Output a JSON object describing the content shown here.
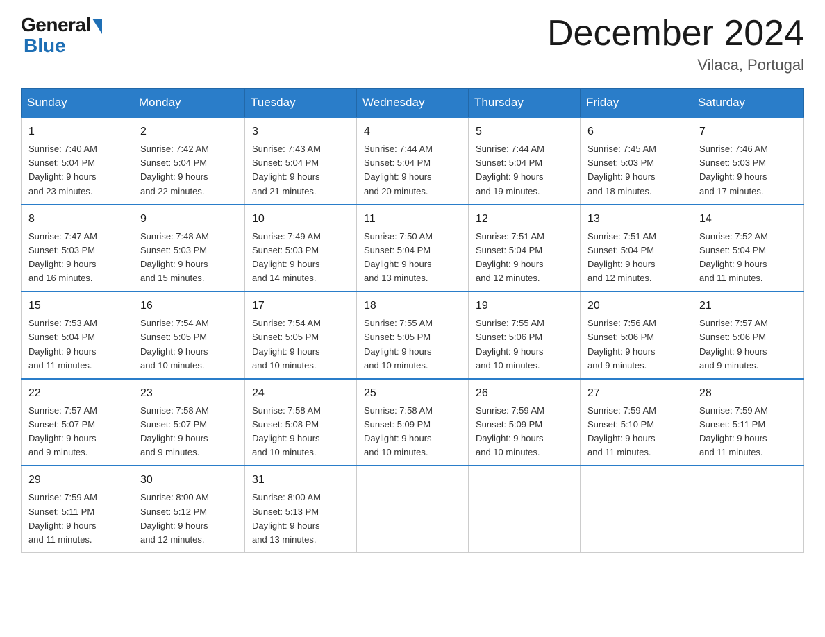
{
  "logo": {
    "general": "General",
    "blue": "Blue"
  },
  "title": "December 2024",
  "location": "Vilaca, Portugal",
  "days_of_week": [
    "Sunday",
    "Monday",
    "Tuesday",
    "Wednesday",
    "Thursday",
    "Friday",
    "Saturday"
  ],
  "weeks": [
    [
      {
        "day": "1",
        "sunrise": "7:40 AM",
        "sunset": "5:04 PM",
        "daylight": "9 hours and 23 minutes."
      },
      {
        "day": "2",
        "sunrise": "7:42 AM",
        "sunset": "5:04 PM",
        "daylight": "9 hours and 22 minutes."
      },
      {
        "day": "3",
        "sunrise": "7:43 AM",
        "sunset": "5:04 PM",
        "daylight": "9 hours and 21 minutes."
      },
      {
        "day": "4",
        "sunrise": "7:44 AM",
        "sunset": "5:04 PM",
        "daylight": "9 hours and 20 minutes."
      },
      {
        "day": "5",
        "sunrise": "7:44 AM",
        "sunset": "5:04 PM",
        "daylight": "9 hours and 19 minutes."
      },
      {
        "day": "6",
        "sunrise": "7:45 AM",
        "sunset": "5:03 PM",
        "daylight": "9 hours and 18 minutes."
      },
      {
        "day": "7",
        "sunrise": "7:46 AM",
        "sunset": "5:03 PM",
        "daylight": "9 hours and 17 minutes."
      }
    ],
    [
      {
        "day": "8",
        "sunrise": "7:47 AM",
        "sunset": "5:03 PM",
        "daylight": "9 hours and 16 minutes."
      },
      {
        "day": "9",
        "sunrise": "7:48 AM",
        "sunset": "5:03 PM",
        "daylight": "9 hours and 15 minutes."
      },
      {
        "day": "10",
        "sunrise": "7:49 AM",
        "sunset": "5:03 PM",
        "daylight": "9 hours and 14 minutes."
      },
      {
        "day": "11",
        "sunrise": "7:50 AM",
        "sunset": "5:04 PM",
        "daylight": "9 hours and 13 minutes."
      },
      {
        "day": "12",
        "sunrise": "7:51 AM",
        "sunset": "5:04 PM",
        "daylight": "9 hours and 12 minutes."
      },
      {
        "day": "13",
        "sunrise": "7:51 AM",
        "sunset": "5:04 PM",
        "daylight": "9 hours and 12 minutes."
      },
      {
        "day": "14",
        "sunrise": "7:52 AM",
        "sunset": "5:04 PM",
        "daylight": "9 hours and 11 minutes."
      }
    ],
    [
      {
        "day": "15",
        "sunrise": "7:53 AM",
        "sunset": "5:04 PM",
        "daylight": "9 hours and 11 minutes."
      },
      {
        "day": "16",
        "sunrise": "7:54 AM",
        "sunset": "5:05 PM",
        "daylight": "9 hours and 10 minutes."
      },
      {
        "day": "17",
        "sunrise": "7:54 AM",
        "sunset": "5:05 PM",
        "daylight": "9 hours and 10 minutes."
      },
      {
        "day": "18",
        "sunrise": "7:55 AM",
        "sunset": "5:05 PM",
        "daylight": "9 hours and 10 minutes."
      },
      {
        "day": "19",
        "sunrise": "7:55 AM",
        "sunset": "5:06 PM",
        "daylight": "9 hours and 10 minutes."
      },
      {
        "day": "20",
        "sunrise": "7:56 AM",
        "sunset": "5:06 PM",
        "daylight": "9 hours and 9 minutes."
      },
      {
        "day": "21",
        "sunrise": "7:57 AM",
        "sunset": "5:06 PM",
        "daylight": "9 hours and 9 minutes."
      }
    ],
    [
      {
        "day": "22",
        "sunrise": "7:57 AM",
        "sunset": "5:07 PM",
        "daylight": "9 hours and 9 minutes."
      },
      {
        "day": "23",
        "sunrise": "7:58 AM",
        "sunset": "5:07 PM",
        "daylight": "9 hours and 9 minutes."
      },
      {
        "day": "24",
        "sunrise": "7:58 AM",
        "sunset": "5:08 PM",
        "daylight": "9 hours and 10 minutes."
      },
      {
        "day": "25",
        "sunrise": "7:58 AM",
        "sunset": "5:09 PM",
        "daylight": "9 hours and 10 minutes."
      },
      {
        "day": "26",
        "sunrise": "7:59 AM",
        "sunset": "5:09 PM",
        "daylight": "9 hours and 10 minutes."
      },
      {
        "day": "27",
        "sunrise": "7:59 AM",
        "sunset": "5:10 PM",
        "daylight": "9 hours and 11 minutes."
      },
      {
        "day": "28",
        "sunrise": "7:59 AM",
        "sunset": "5:11 PM",
        "daylight": "9 hours and 11 minutes."
      }
    ],
    [
      {
        "day": "29",
        "sunrise": "7:59 AM",
        "sunset": "5:11 PM",
        "daylight": "9 hours and 11 minutes."
      },
      {
        "day": "30",
        "sunrise": "8:00 AM",
        "sunset": "5:12 PM",
        "daylight": "9 hours and 12 minutes."
      },
      {
        "day": "31",
        "sunrise": "8:00 AM",
        "sunset": "5:13 PM",
        "daylight": "9 hours and 13 minutes."
      },
      null,
      null,
      null,
      null
    ]
  ],
  "labels": {
    "sunrise": "Sunrise:",
    "sunset": "Sunset:",
    "daylight": "Daylight: 9 hours"
  }
}
